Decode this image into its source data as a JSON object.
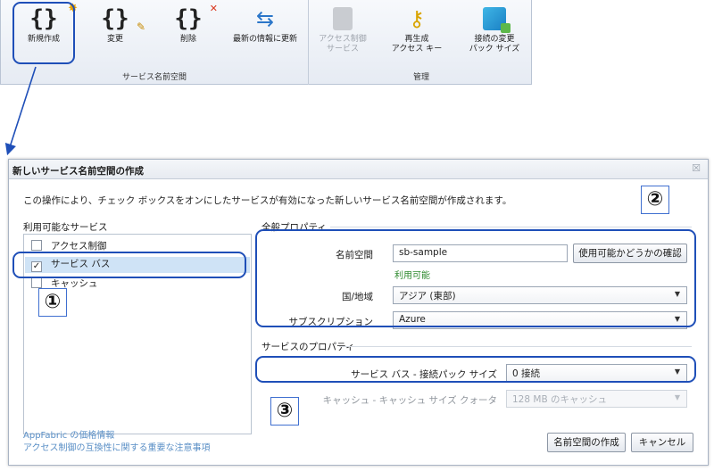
{
  "ribbon": {
    "groups": [
      {
        "label": "サービス名前空間",
        "buttons": [
          {
            "label": "新規作成",
            "icon": "new-namespace-icon"
          },
          {
            "label": "変更",
            "icon": "modify-namespace-icon"
          },
          {
            "label": "削除",
            "icon": "delete-namespace-icon"
          },
          {
            "label": "最新の情報に更新",
            "icon": "refresh-icon"
          }
        ]
      },
      {
        "label": "管理",
        "buttons": [
          {
            "label": "アクセス制御\nサービス",
            "icon": "access-control-icon",
            "disabled": true
          },
          {
            "label": "再生成\nアクセス キー",
            "icon": "key-icon"
          },
          {
            "label": "接続の変更\nパック サイズ",
            "icon": "connection-pack-icon"
          }
        ]
      }
    ]
  },
  "dialog": {
    "title": "新しいサービス名前空間の作成",
    "close_glyph": "☒",
    "description": "この操作により、チェック ボックスをオンにしたサービスが有効になった新しいサービス名前空間が作成されます。",
    "available_services": {
      "label": "利用可能なサービス",
      "items": [
        {
          "label": "アクセス制御",
          "checked": false
        },
        {
          "label": "サービス バス",
          "checked": true
        },
        {
          "label": "キャッシュ",
          "checked": false
        }
      ]
    },
    "general_properties": {
      "label": "全般プロパティ",
      "namespace_label": "名前空間",
      "namespace_value": "sb-sample",
      "check_availability_label": "使用可能かどうかの確認",
      "availability_status": "利用可能",
      "region_label": "国/地域",
      "region_value": "アジア (東部)",
      "subscription_label": "サブスクリプション",
      "subscription_value": "Azure"
    },
    "service_properties": {
      "label": "サービスのプロパティ",
      "servicebus_pack_label": "サービス バス - 接続パック サイズ",
      "servicebus_pack_value": "0 接続",
      "cache_quota_label": "キャッシュ - キャッシュ サイズ クォータ",
      "cache_quota_value": "128 MB のキャッシュ"
    },
    "links": {
      "pricing": "AppFabric の価格情報",
      "notice": "アクセス制御の互換性に関する重要な注意事項"
    },
    "buttons": {
      "create": "名前空間の作成",
      "cancel": "キャンセル"
    }
  },
  "annotations": {
    "badge_1": "①",
    "badge_2": "②",
    "badge_3": "③",
    "color": "#1f4fb8"
  }
}
